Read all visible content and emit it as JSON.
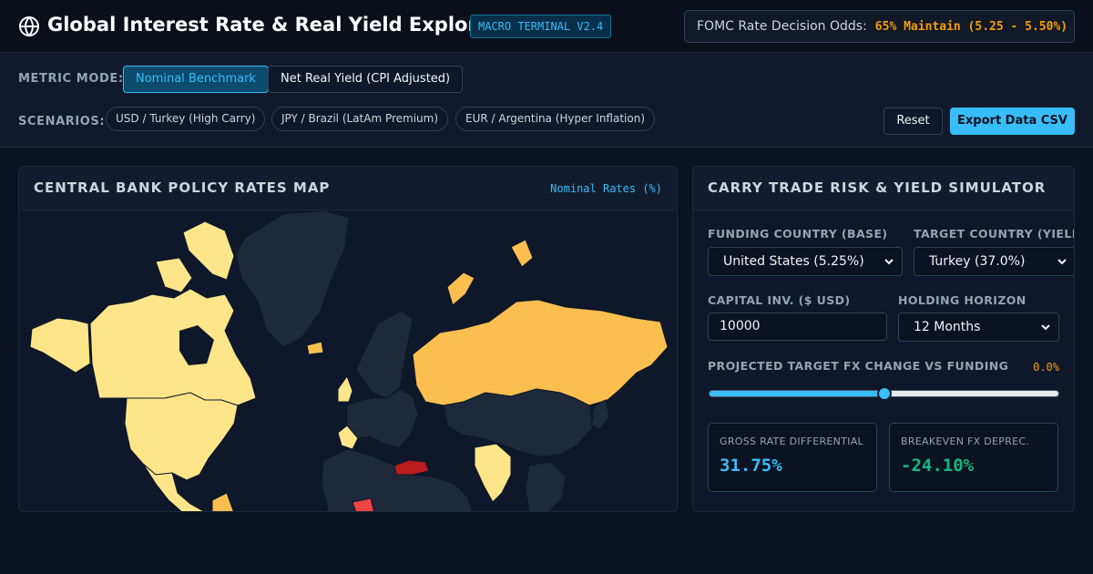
{
  "header": {
    "title": "Global Interest Rate & Real Yield Explorer",
    "version_badge": "MACRO TERMINAL V2.4",
    "odds_label": "FOMC Rate Decision Odds:",
    "odds_value": "65% Maintain (5.25 - 5.50%)"
  },
  "controls": {
    "metric_mode_label": "METRIC MODE:",
    "metric_modes": [
      {
        "label": "Nominal Benchmark",
        "active": true
      },
      {
        "label": "Net Real Yield (CPI Adjusted)",
        "active": false
      }
    ],
    "scenarios_label": "SCENARIOS:",
    "scenarios": [
      "USD / Turkey (High Carry)",
      "JPY / Brazil (LatAm Premium)",
      "EUR / Argentina (Hyper Inflation)"
    ],
    "reset_label": "Reset",
    "export_label": "Export Data CSV"
  },
  "map_panel": {
    "title": "CENTRAL BANK POLICY RATES MAP",
    "tag": "Nominal Rates (%)",
    "colors": {
      "low": "#fde68a",
      "mid": "#fbbf4f",
      "high": "#f97316",
      "very_high": "#ef4444",
      "extreme": "#b91c1c",
      "no_data": "#1e293b"
    }
  },
  "simulator": {
    "title": "CARRY TRADE RISK & YIELD SIMULATOR",
    "funding_label": "FUNDING COUNTRY (BASE)",
    "funding_value": "United States (5.25%)",
    "target_label": "TARGET COUNTRY (YIELD)",
    "target_value": "Turkey (37.0%)",
    "capital_label": "CAPITAL INV. ($ USD)",
    "capital_value": "10000",
    "horizon_label": "HOLDING HORIZON",
    "horizon_value": "12 Months",
    "fx_label": "PROJECTED TARGET FX CHANGE VS FUNDING",
    "fx_value": "0.0%",
    "fx_slider_fraction": 0.5,
    "gross_label": "GROSS RATE DIFFERENTIAL",
    "gross_value": "31.75%",
    "gross_color": "#38bdf8",
    "breakeven_label": "BREAKEVEN FX DEPREC.",
    "breakeven_value": "-24.10%",
    "breakeven_color": "#10b981"
  }
}
